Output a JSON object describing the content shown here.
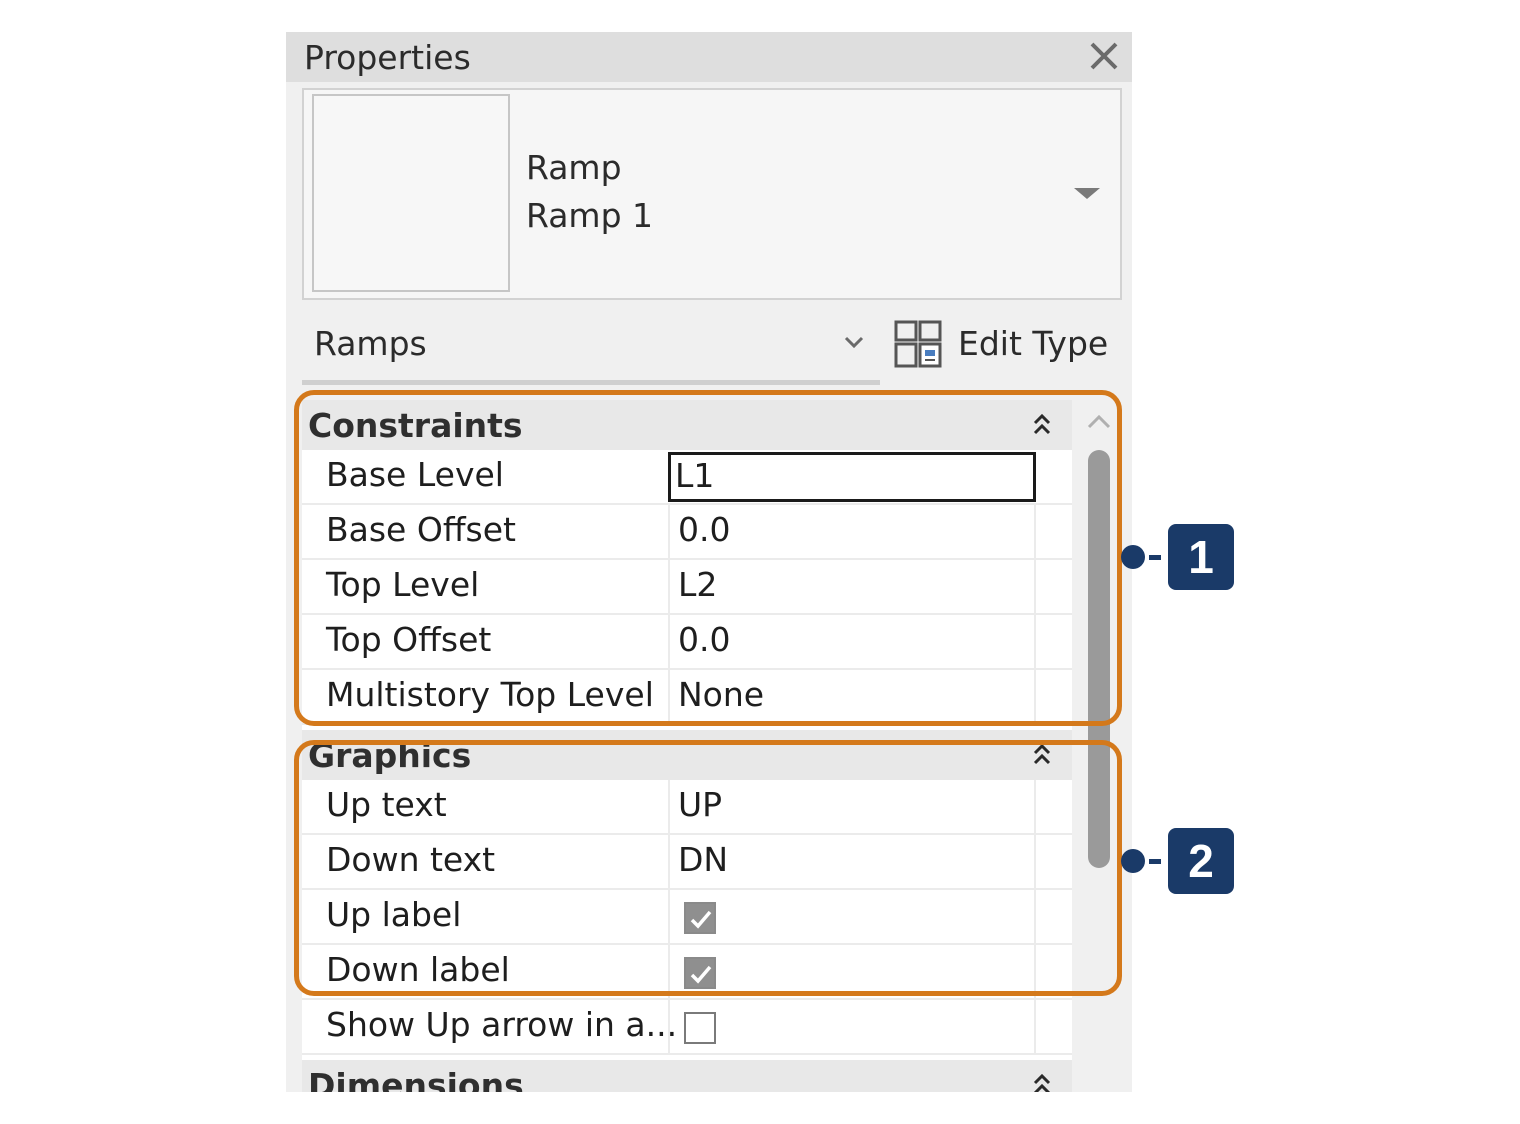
{
  "panel": {
    "title": "Properties",
    "close_icon": "close-icon"
  },
  "type_selector": {
    "family": "Ramp",
    "type_name": "Ramp 1",
    "dropdown_icon": "triangle-down-icon"
  },
  "filter": {
    "label": "Ramps",
    "chevron_icon": "chevron-down-icon"
  },
  "edit_type": {
    "label": "Edit Type",
    "icon": "edit-type-icon"
  },
  "groups": {
    "constraints": {
      "label": "Constraints",
      "rows": [
        {
          "name": "Base Level",
          "value": "L1"
        },
        {
          "name": "Base Offset",
          "value": "0.0"
        },
        {
          "name": "Top Level",
          "value": "L2"
        },
        {
          "name": "Top Offset",
          "value": "0.0"
        },
        {
          "name": "Multistory Top Level",
          "value": "None"
        }
      ]
    },
    "graphics": {
      "label": "Graphics",
      "rows": [
        {
          "name": "Up text",
          "value": "UP"
        },
        {
          "name": "Down text",
          "value": "DN"
        },
        {
          "name": "Up label",
          "checked": true
        },
        {
          "name": "Down label",
          "checked": true
        },
        {
          "name": "Show Up arrow in a...",
          "checked": false
        }
      ]
    },
    "dimensions": {
      "label": "Dimensions"
    }
  },
  "callouts": [
    {
      "number": "1"
    },
    {
      "number": "2"
    }
  ],
  "colors": {
    "callout_border": "#d4791b",
    "callout_badge": "#1a3a68",
    "panel_bg": "#f0f0f0"
  }
}
